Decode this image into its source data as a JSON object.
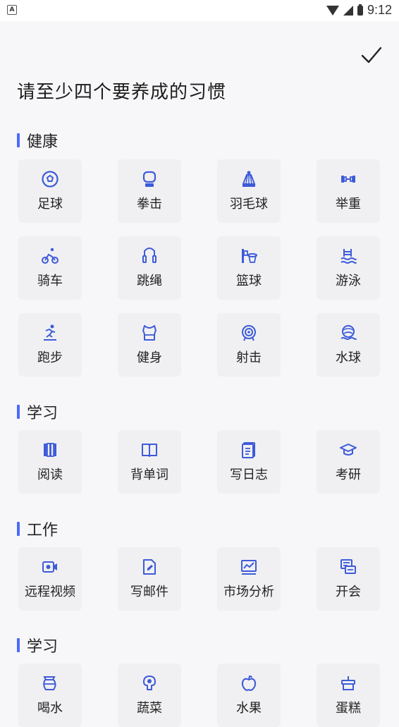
{
  "status": {
    "time": "9:12",
    "left_icon": "A"
  },
  "header": {
    "confirm_icon": "check-icon",
    "title": "请至少四个要养成的习惯"
  },
  "sections": [
    {
      "title": "健康",
      "items": [
        {
          "label": "足球",
          "icon": "soccer-icon"
        },
        {
          "label": "拳击",
          "icon": "boxing-glove-icon"
        },
        {
          "label": "羽毛球",
          "icon": "shuttlecock-icon"
        },
        {
          "label": "举重",
          "icon": "dumbbell-icon"
        },
        {
          "label": "骑车",
          "icon": "bicycle-icon"
        },
        {
          "label": "跳绳",
          "icon": "jump-rope-icon"
        },
        {
          "label": "篮球",
          "icon": "basketball-hoop-icon"
        },
        {
          "label": "游泳",
          "icon": "swimming-pool-icon"
        },
        {
          "label": "跑步",
          "icon": "running-icon"
        },
        {
          "label": "健身",
          "icon": "fitness-top-icon"
        },
        {
          "label": "射击",
          "icon": "target-icon"
        },
        {
          "label": "水球",
          "icon": "water-polo-icon"
        }
      ]
    },
    {
      "title": "学习",
      "items": [
        {
          "label": "阅读",
          "icon": "books-icon"
        },
        {
          "label": "背单词",
          "icon": "open-book-icon"
        },
        {
          "label": "写日志",
          "icon": "journal-icon"
        },
        {
          "label": "考研",
          "icon": "graduation-cap-icon"
        }
      ]
    },
    {
      "title": "工作",
      "items": [
        {
          "label": "远程视频",
          "icon": "video-call-icon"
        },
        {
          "label": "写邮件",
          "icon": "edit-document-icon"
        },
        {
          "label": "市场分析",
          "icon": "chart-icon"
        },
        {
          "label": "开会",
          "icon": "meeting-icon"
        }
      ]
    },
    {
      "title": "学习",
      "items": [
        {
          "label": "喝水",
          "icon": "kettle-icon"
        },
        {
          "label": "蔬菜",
          "icon": "vegetable-icon"
        },
        {
          "label": "水果",
          "icon": "apple-icon"
        },
        {
          "label": "蛋糕",
          "icon": "cake-icon"
        }
      ]
    }
  ],
  "colors": {
    "accent": "#4a6cf7",
    "icon": "#3d5bd9"
  }
}
